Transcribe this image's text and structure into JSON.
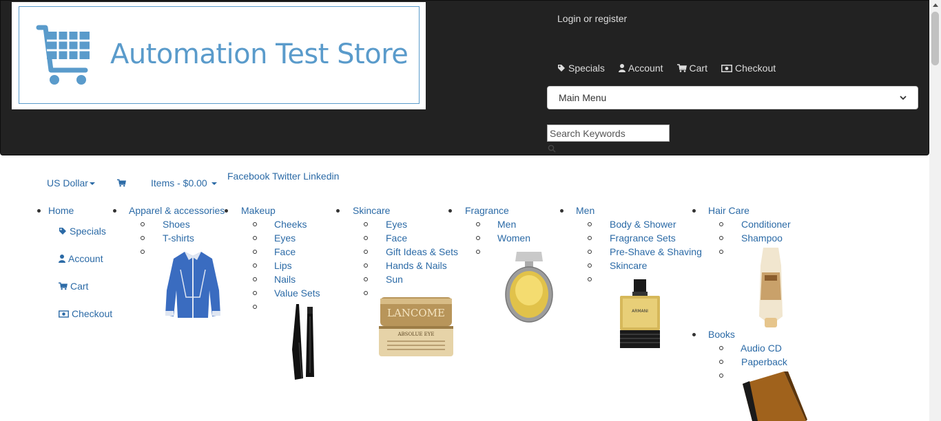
{
  "header": {
    "logo_text": "Automation Test Store",
    "login_label": "Login or register",
    "top_links": [
      {
        "label": "Specials",
        "icon": "tag-icon"
      },
      {
        "label": "Account",
        "icon": "user-icon"
      },
      {
        "label": "Cart",
        "icon": "cart-icon"
      },
      {
        "label": "Checkout",
        "icon": "money-icon"
      }
    ],
    "main_menu_selected": "Main Menu",
    "search_placeholder": "Search Keywords"
  },
  "bar": {
    "currency": "US Dollar",
    "items_total": "Items - $0.00",
    "social": "Facebook Twitter Linkedin"
  },
  "nav": {
    "home": "Home",
    "home_links": [
      "Specials",
      "Account",
      "Cart",
      "Checkout"
    ],
    "categories": [
      {
        "title": "Apparel & accessories",
        "subs": [
          "Shoes",
          "T-shirts"
        ]
      },
      {
        "title": "Makeup",
        "subs": [
          "Cheeks",
          "Eyes",
          "Face",
          "Lips",
          "Nails",
          "Value Sets"
        ]
      },
      {
        "title": "Skincare",
        "subs": [
          "Eyes",
          "Face",
          "Gift Ideas & Sets",
          "Hands & Nails",
          "Sun"
        ]
      },
      {
        "title": "Fragrance",
        "subs": [
          "Men",
          "Women"
        ]
      },
      {
        "title": "Men",
        "subs": [
          "Body & Shower",
          "Fragrance Sets",
          "Pre-Shave & Shaving",
          "Skincare"
        ]
      },
      {
        "title": "Hair Care",
        "subs": [
          "Conditioner",
          "Shampoo"
        ]
      },
      {
        "title": "Books",
        "subs": [
          "Audio CD",
          "Paperback"
        ]
      }
    ]
  },
  "image_text": {
    "lancome_brand": "LANCOME",
    "lancome_product": "ABSOLUE EYE",
    "armani_brand": "ARMANI"
  },
  "colors": {
    "header_bg": "#222222",
    "link": "#2b6aa6",
    "logo_blue": "#5a9bcb"
  }
}
